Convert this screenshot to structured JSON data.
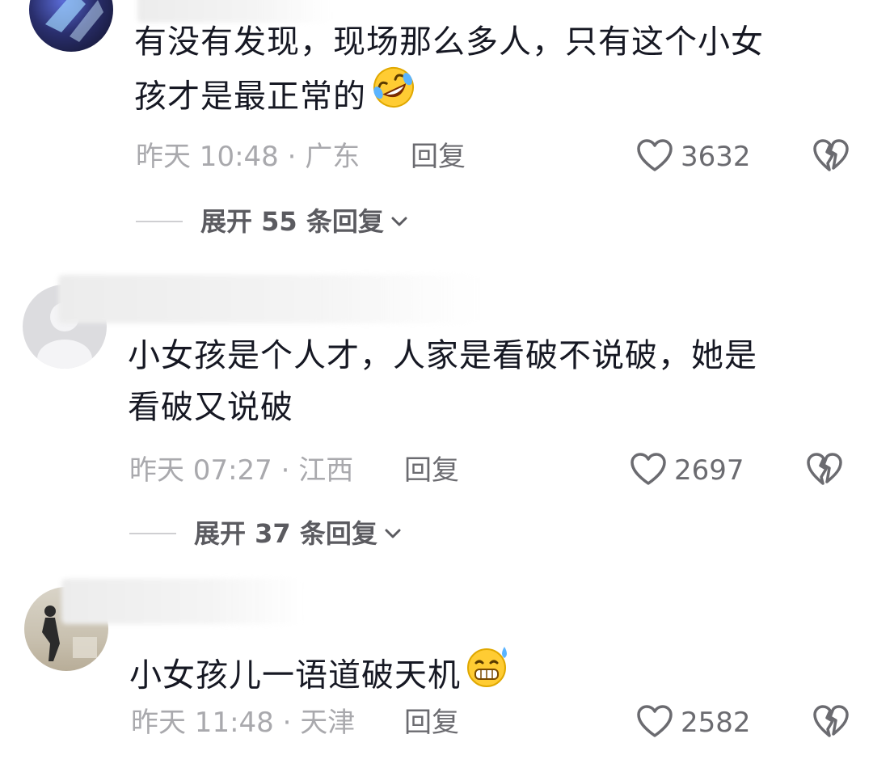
{
  "comments": [
    {
      "text_lines": [
        "有没有发现，现场那么多人，只有这个小女",
        "孩才是最正常的"
      ],
      "emoji": "rolling-laughing-emoji",
      "meta": "昨天 10:48 · 广东",
      "reply_label": "回复",
      "likes": "3632",
      "expand_label": "展开 55 条回复"
    },
    {
      "text_lines": [
        "小女孩是个人才，人家是看破不说破，她是",
        "看破又说破"
      ],
      "emoji": "",
      "meta": "昨天 07:27 · 江西",
      "reply_label": "回复",
      "likes": "2697",
      "expand_label": "展开 37 条回复"
    },
    {
      "text_lines": [
        "小女孩儿一语道破天机"
      ],
      "emoji": "sweat-grin-emoji",
      "meta": "昨天 11:48 · 天津",
      "reply_label": "回复",
      "likes": "2582"
    }
  ],
  "colors": {
    "text": "#161823",
    "meta": "#a9a9ad",
    "action": "#6b6b70"
  },
  "icons": [
    "heart-outline-icon",
    "broken-heart-icon",
    "chevron-down-icon"
  ]
}
